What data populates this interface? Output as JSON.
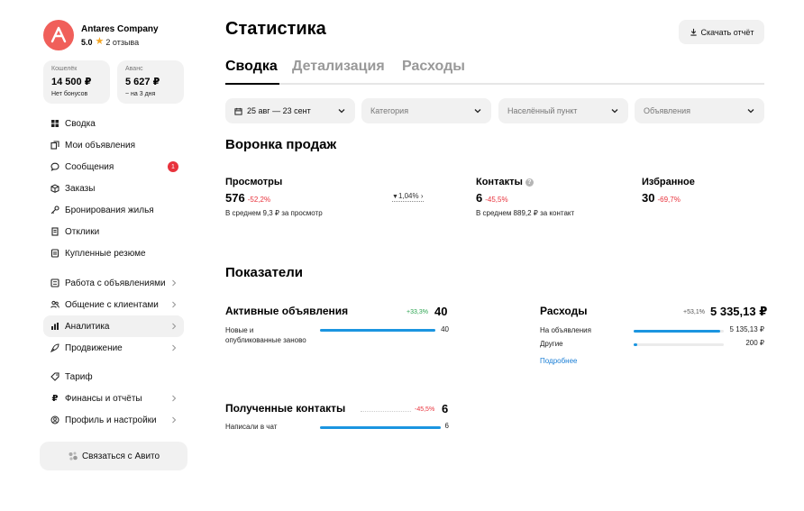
{
  "company": {
    "name": "Antares Company",
    "rating": "5.0",
    "reviews": "2 отзыва"
  },
  "wallet": {
    "label": "Кошелёк",
    "value": "14 500 ₽",
    "sub": "Нет бонусов"
  },
  "advance": {
    "label": "Аванс",
    "value": "5 627 ₽",
    "sub": "~ на 3 дня"
  },
  "nav": {
    "svodka": "Сводка",
    "ads": "Мои объявления",
    "messages": "Сообщения",
    "messages_badge": "1",
    "orders": "Заказы",
    "booking": "Бронирования жилья",
    "responses": "Отклики",
    "resumes": "Купленные резюме",
    "work_ads": "Работа с объявлениями",
    "clients": "Общение с клиентами",
    "analytics": "Аналитика",
    "promotion": "Продвижение",
    "tariff": "Тариф",
    "finance": "Финансы и отчёты",
    "profile": "Профиль и настройки"
  },
  "contact_button": "Связаться с Авито",
  "header": {
    "title": "Статистика",
    "download": "Скачать отчёт"
  },
  "tabs": [
    "Сводка",
    "Детализация",
    "Расходы"
  ],
  "filters": {
    "date": "25 авг — 23 сент",
    "category": "Категория",
    "city": "Населённый пункт",
    "ads": "Объявления"
  },
  "funnel": {
    "title": "Воронка продаж",
    "views": {
      "name": "Просмотры",
      "value": "576",
      "delta": "-52,2%",
      "sub": "В среднем 9,3 ₽ за просмотр"
    },
    "conversion": "1,04%",
    "contacts": {
      "name": "Контакты",
      "value": "6",
      "delta": "-45,5%",
      "sub": "В среднем 889,2 ₽ за контакт"
    },
    "favorites": {
      "name": "Избранное",
      "value": "30",
      "delta": "-69,7%"
    }
  },
  "indicators": {
    "title": "Показатели",
    "active": {
      "title": "Активные объявления",
      "delta": "+33,3%",
      "value": "40",
      "row_label": "Новые и опубликованные заново",
      "row_value": "40",
      "row_fill": 1.0
    },
    "expenses": {
      "title": "Расходы",
      "delta": "+53,1%",
      "value": "5 335,13 ₽",
      "rows": [
        {
          "label": "На объявления",
          "value": "5 135,13 ₽",
          "fill": 0.96
        },
        {
          "label": "Другие",
          "value": "200 ₽",
          "fill": 0.04
        }
      ],
      "more": "Подробнее"
    },
    "contacts": {
      "title": "Полученные контакты",
      "delta": "-45,5%",
      "value": "6",
      "row_label": "Написали в чат",
      "row_value": "6",
      "row_fill": 1.0
    }
  },
  "colors": {
    "accent_blue": "#1b95e0",
    "negative": "#e8323c",
    "positive": "#2aa44f",
    "logo": "#f05f5a"
  }
}
